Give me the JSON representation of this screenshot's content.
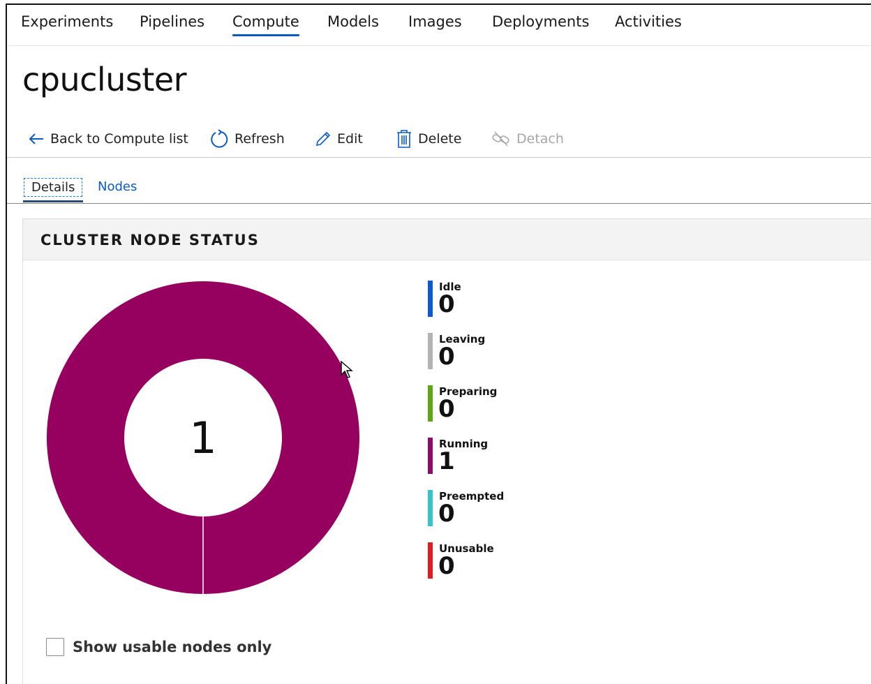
{
  "nav": {
    "items": [
      {
        "label": "Experiments",
        "active": false
      },
      {
        "label": "Pipelines",
        "active": false
      },
      {
        "label": "Compute",
        "active": true
      },
      {
        "label": "Models",
        "active": false
      },
      {
        "label": "Images",
        "active": false
      },
      {
        "label": "Deployments",
        "active": false
      },
      {
        "label": "Activities",
        "active": false
      }
    ]
  },
  "page": {
    "title": "cpucluster"
  },
  "commands": {
    "back": "Back to Compute list",
    "refresh": "Refresh",
    "edit": "Edit",
    "delete": "Delete",
    "detach": "Detach"
  },
  "tabs": {
    "details": "Details",
    "nodes": "Nodes",
    "active": "Details"
  },
  "panel": {
    "title": "CLUSTER NODE STATUS",
    "total": "1",
    "show_usable_label": "Show usable nodes only",
    "show_usable_checked": false
  },
  "chart_data": {
    "type": "pie",
    "categories": [
      "Idle",
      "Leaving",
      "Preparing",
      "Running",
      "Preempted",
      "Unusable"
    ],
    "values": [
      0,
      0,
      0,
      1,
      0,
      0
    ],
    "colors": [
      "#0a5bd0",
      "#b3b3b3",
      "#5ea614",
      "#8c0c6c",
      "#36c3cc",
      "#e01b22"
    ],
    "donut_color": "#96005e"
  }
}
